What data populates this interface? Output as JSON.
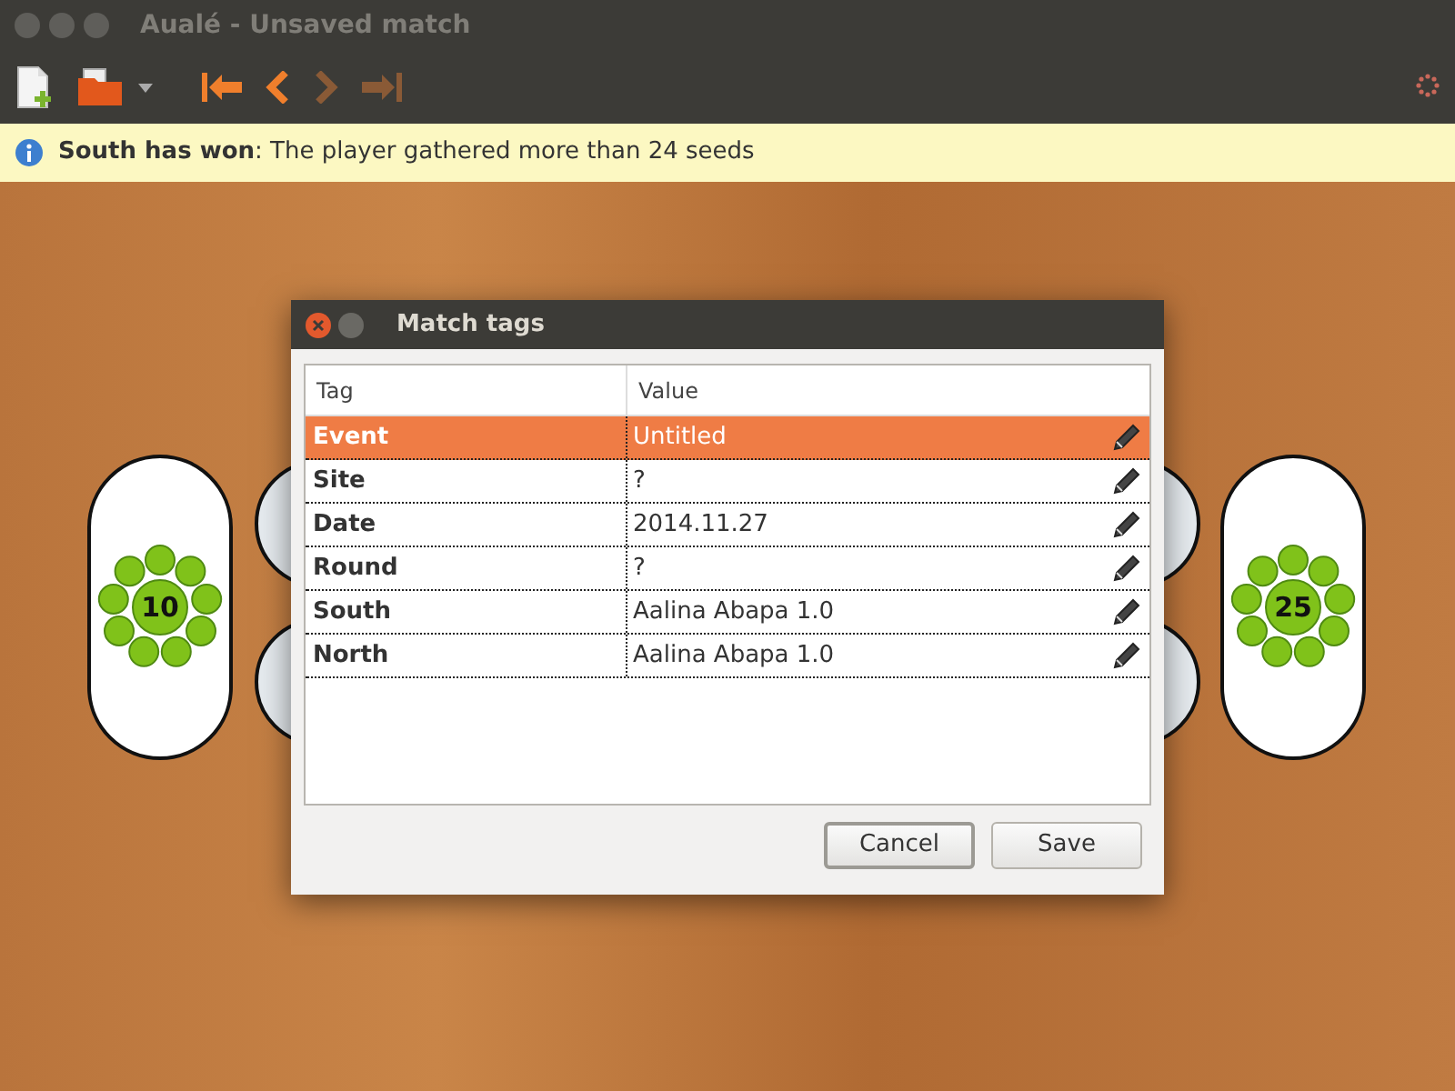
{
  "window": {
    "title": "Aualé - Unsaved match"
  },
  "toolbar": {
    "buttons": [
      {
        "kind": "new"
      },
      {
        "kind": "open"
      },
      {
        "kind": "dropdown"
      },
      {
        "kind": "first"
      },
      {
        "kind": "prev"
      },
      {
        "kind": "next"
      },
      {
        "kind": "last"
      }
    ]
  },
  "info_bar": {
    "message": "**South has won**: The player gathered more than 24 seeds"
  },
  "board": {
    "stores": [
      {
        "count": "10"
      },
      {
        "count": "25"
      }
    ]
  },
  "dialog": {
    "title": "Match tags",
    "columns": [
      "Tag",
      "Value"
    ],
    "rows": [
      {
        "tag": "Event",
        "value": "Untitled",
        "selected": true
      },
      {
        "tag": "Site",
        "value": "?",
        "selected": false
      },
      {
        "tag": "Date",
        "value": "2014.11.27",
        "selected": false
      },
      {
        "tag": "Round",
        "value": "?",
        "selected": false
      },
      {
        "tag": "South",
        "value": "Aalina Abapa 1.0",
        "selected": false
      },
      {
        "tag": "North",
        "value": "Aalina Abapa 1.0",
        "selected": false
      }
    ],
    "buttons": [
      {
        "label": "Cancel",
        "focused": true
      },
      {
        "label": "Save",
        "focused": false
      }
    ]
  }
}
